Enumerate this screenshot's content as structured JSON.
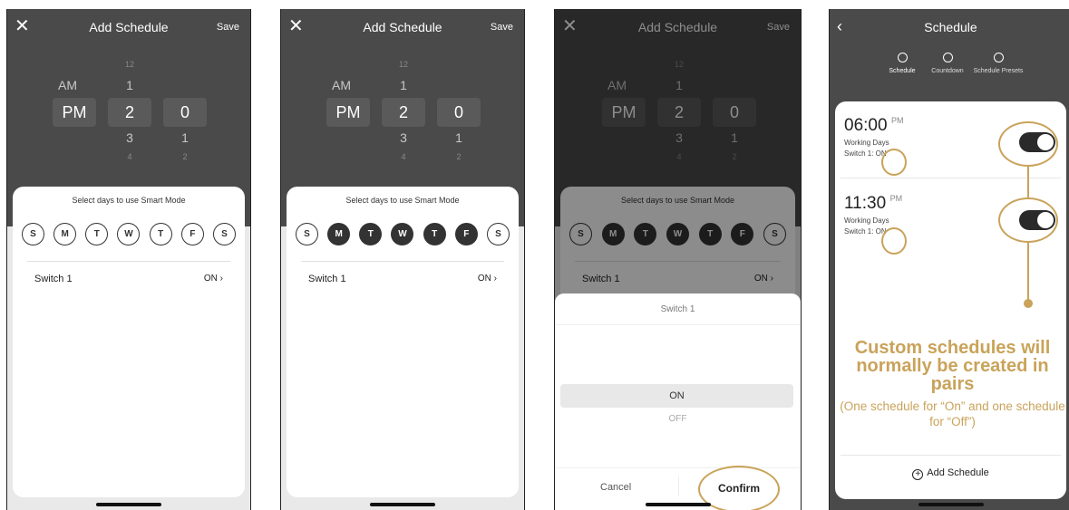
{
  "add_schedule": {
    "title": "Add Schedule",
    "save_label": "Save",
    "close_icon": "close-icon",
    "picker": {
      "ampm": [
        "AM",
        "PM"
      ],
      "hours": [
        "12",
        "1",
        "2",
        "3",
        "4"
      ],
      "minutes": [
        "0",
        "1",
        "2"
      ],
      "selected": {
        "ampm": "PM",
        "hour": "2",
        "minute": "0"
      }
    },
    "days_prompt": "Select days to use Smart Mode",
    "days": [
      "S",
      "M",
      "T",
      "W",
      "T",
      "F",
      "S"
    ],
    "days_selected_step2": [
      false,
      true,
      true,
      true,
      true,
      true,
      false
    ],
    "switch_label": "Switch 1",
    "switch_value": "ON",
    "chevron_icon": "chevron-right-icon"
  },
  "switch_sheet": {
    "title": "Switch 1",
    "options": [
      "ON",
      "OFF"
    ],
    "selected": "ON",
    "cancel_label": "Cancel",
    "confirm_label": "Confirm"
  },
  "schedule_list": {
    "title": "Schedule",
    "back_icon": "chevron-left-icon",
    "tabs": [
      {
        "label": "Schedule",
        "icon": "alarm-icon"
      },
      {
        "label": "Countdown",
        "icon": "clock-icon"
      },
      {
        "label": "Schedule Presets",
        "icon": "clock-icon"
      }
    ],
    "items": [
      {
        "time": "06:00",
        "ampm": "PM",
        "days": "Working Days",
        "switch_text": "Switch 1: ON",
        "enabled": true
      },
      {
        "time": "11:30",
        "ampm": "PM",
        "days": "Working Days",
        "switch_text": "Switch 1: ON",
        "enabled": true
      }
    ],
    "callout_main": "Custom schedules will normally be created in pairs",
    "callout_sub": "(One schedule for “On” and one schedule for “Off”)",
    "add_label": "Add Schedule",
    "accent_color": "#c9a35a"
  }
}
